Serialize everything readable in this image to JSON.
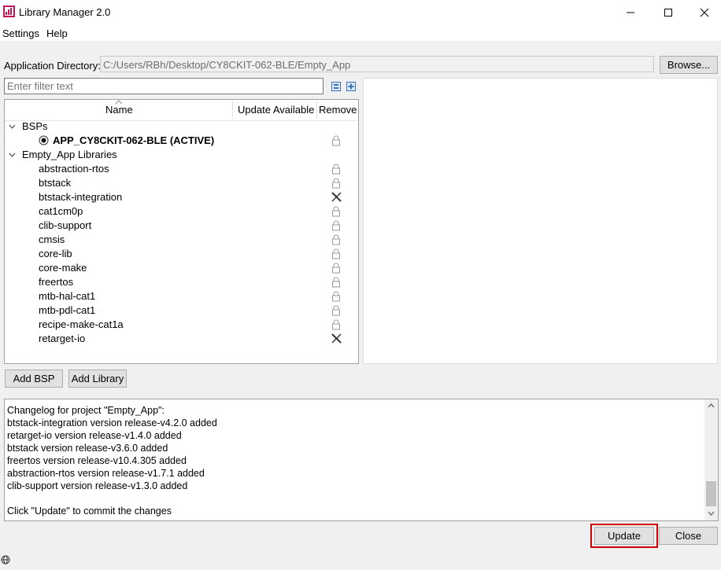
{
  "window": {
    "title": "Library Manager 2.0"
  },
  "menu": {
    "items": [
      {
        "label": "Settings"
      },
      {
        "label": "Help"
      }
    ]
  },
  "app_dir": {
    "label": "Application Directory:",
    "value": "C:/Users/RBh/Desktop/CY8CKIT-062-BLE/Empty_App",
    "browse_label": "Browse..."
  },
  "filter": {
    "placeholder": "Enter filter text"
  },
  "table": {
    "columns": {
      "name": "Name",
      "update": "Update Available",
      "remove": "Remove"
    },
    "groups": [
      {
        "label": "BSPs",
        "items": [
          {
            "label": "APP_CY8CKIT-062-BLE (ACTIVE)",
            "remove": "lock"
          }
        ]
      },
      {
        "label": "Empty_App Libraries",
        "items": [
          {
            "label": "abstraction-rtos",
            "remove": "lock"
          },
          {
            "label": "btstack",
            "remove": "lock"
          },
          {
            "label": "btstack-integration",
            "remove": "x"
          },
          {
            "label": "cat1cm0p",
            "remove": "lock"
          },
          {
            "label": "clib-support",
            "remove": "lock"
          },
          {
            "label": "cmsis",
            "remove": "lock"
          },
          {
            "label": "core-lib",
            "remove": "lock"
          },
          {
            "label": "core-make",
            "remove": "lock"
          },
          {
            "label": "freertos",
            "remove": "lock"
          },
          {
            "label": "mtb-hal-cat1",
            "remove": "lock"
          },
          {
            "label": "mtb-pdl-cat1",
            "remove": "lock"
          },
          {
            "label": "recipe-make-cat1a",
            "remove": "lock"
          },
          {
            "label": "retarget-io",
            "remove": "x"
          }
        ]
      }
    ]
  },
  "buttons": {
    "add_bsp": "Add BSP",
    "add_library": "Add Library",
    "update": "Update",
    "close": "Close"
  },
  "changelog": {
    "lines": [
      "Changelog for project \"Empty_App\":",
      "btstack-integration version release-v4.2.0 added",
      "retarget-io version release-v1.4.0 added",
      "btstack version release-v3.6.0 added",
      "freertos version release-v10.4.305 added",
      "abstraction-rtos version release-v1.7.1 added",
      "clib-support version release-v1.3.0 added",
      "",
      "Click \"Update\" to commit the changes"
    ]
  },
  "colors": {
    "highlight": "#d00000",
    "tree_bg": "#ffffff",
    "window_bg": "#f0f0f0"
  }
}
